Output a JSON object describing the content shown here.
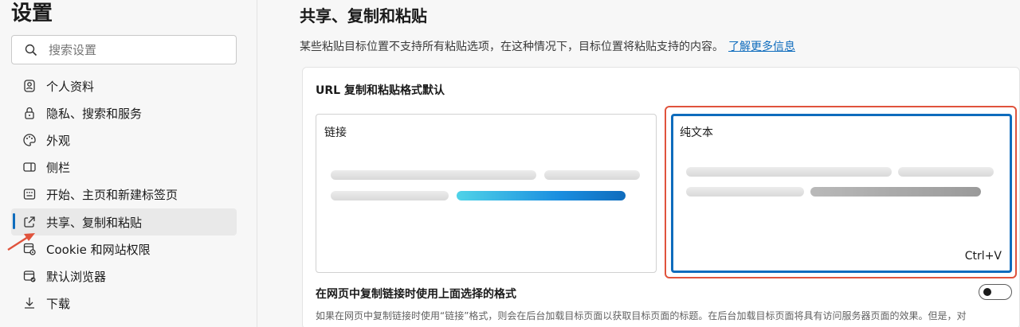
{
  "sidebar": {
    "title": "设置",
    "search_placeholder": "搜索设置",
    "items": [
      {
        "label": "个人资料",
        "icon": "profile-icon"
      },
      {
        "label": "隐私、搜索和服务",
        "icon": "lock-icon"
      },
      {
        "label": "外观",
        "icon": "palette-icon"
      },
      {
        "label": "侧栏",
        "icon": "sidebar-icon"
      },
      {
        "label": "开始、主页和新建标签页",
        "icon": "home-grid-icon"
      },
      {
        "label": "共享、复制和粘贴",
        "icon": "share-icon",
        "active": true
      },
      {
        "label": "Cookie 和网站权限",
        "icon": "site-permissions-icon"
      },
      {
        "label": "默认浏览器",
        "icon": "browser-icon"
      },
      {
        "label": "下载",
        "icon": "download-icon"
      }
    ]
  },
  "main": {
    "title": "共享、复制和粘贴",
    "description": "某些粘贴目标位置不支持所有粘贴选项，在这种情况下，目标位置将粘贴支持的内容。",
    "learn_more": "了解更多信息",
    "card": {
      "title": "URL 复制和粘贴格式默认",
      "option_link": "链接",
      "option_plain": "纯文本",
      "shortcut": "Ctrl+V",
      "toggle_label": "在网页中复制链接时使用上面选择的格式",
      "toggle_on": false,
      "toggle_desc": "如果在网页中复制链接时使用“链接”格式，则会在后台加载目标页面以获取目标页面的标题。在后台加载目标页面将具有访问服务器页面的效果。但是，对"
    }
  },
  "colors": {
    "accent": "#0f6cbd",
    "annotation": "#e0533c"
  }
}
